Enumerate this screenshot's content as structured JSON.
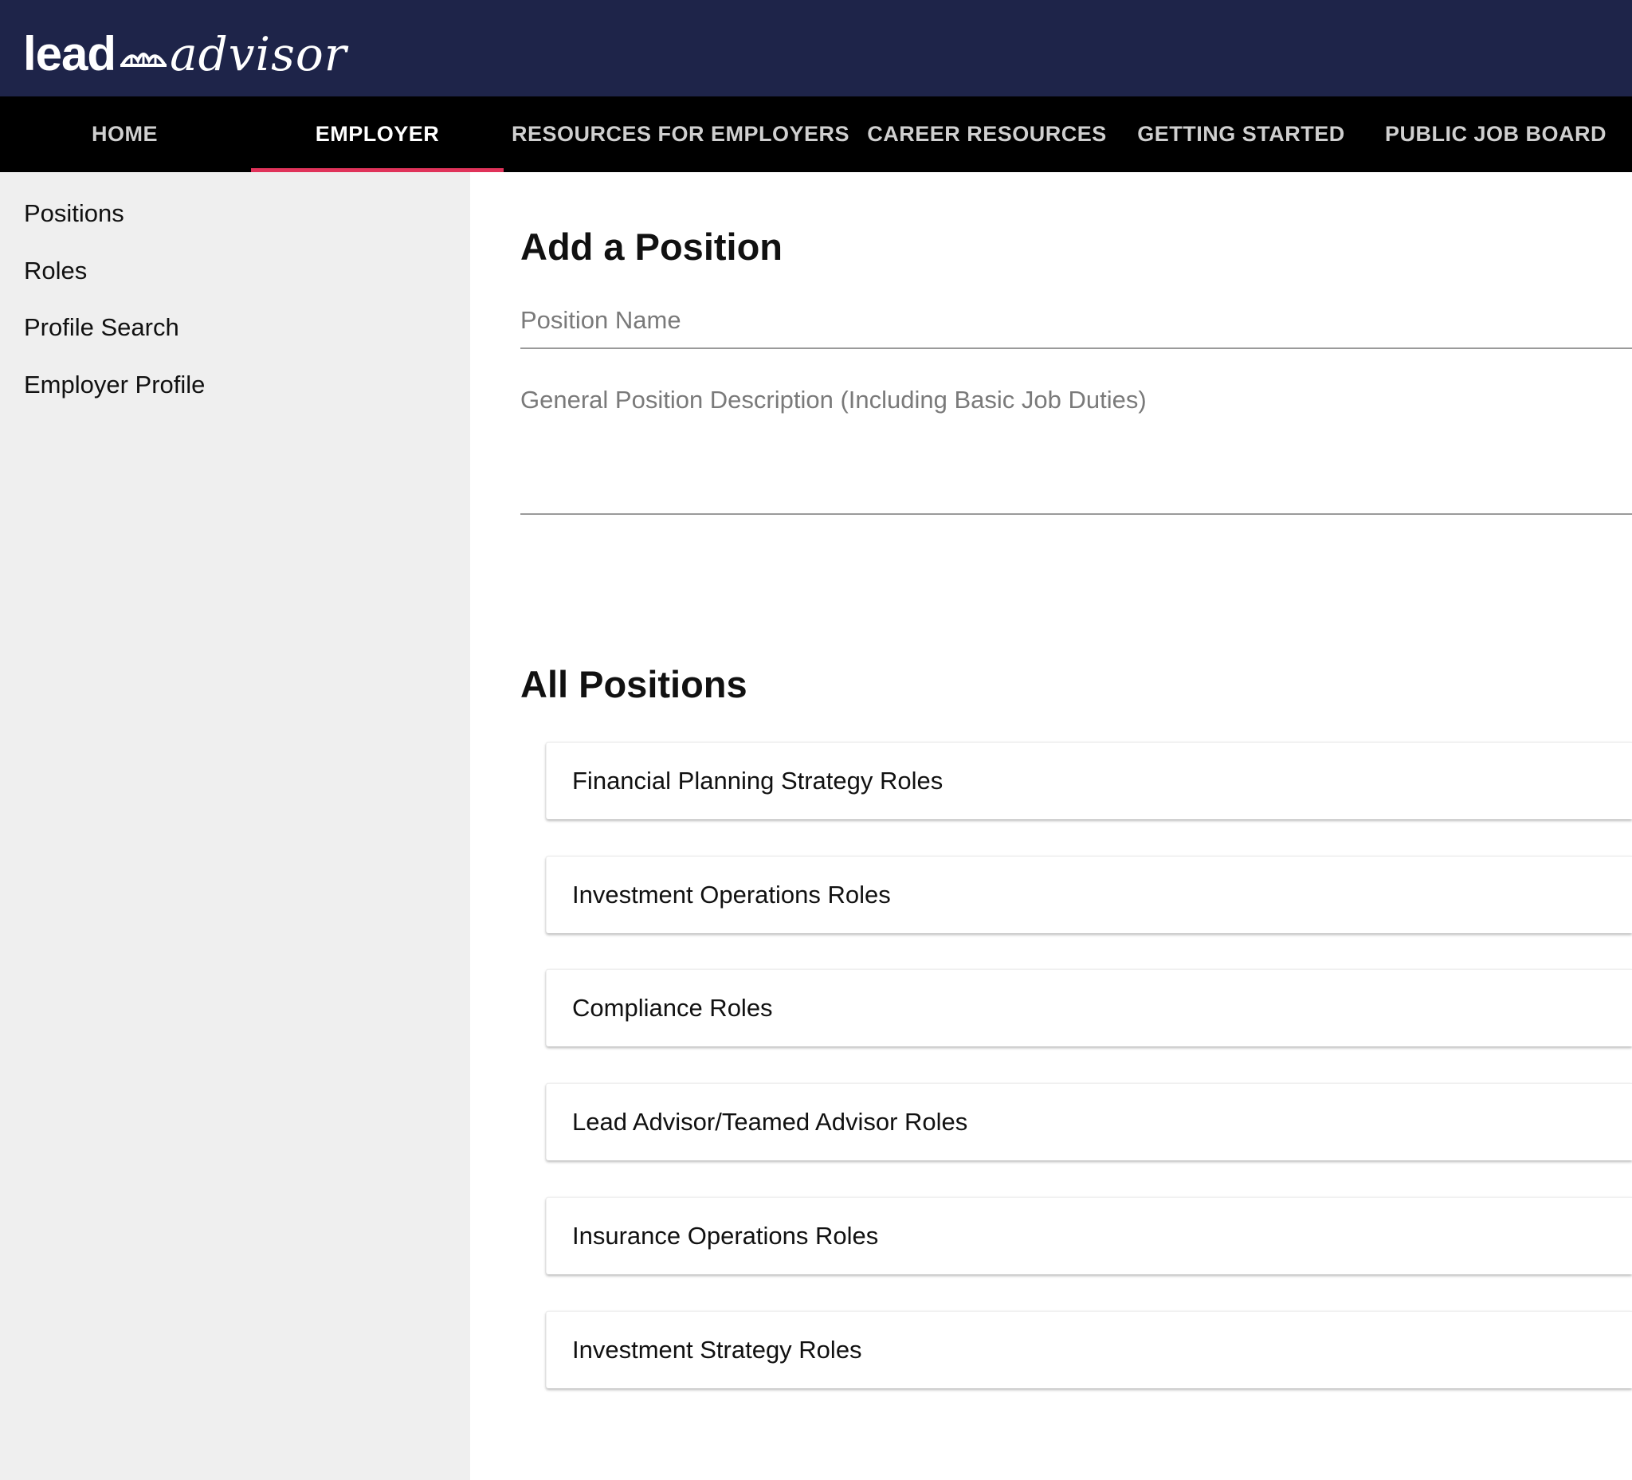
{
  "brand": {
    "logo_part_1": "lead",
    "logo_part_2": "advisor",
    "bar_color": "#1e2449"
  },
  "nav": {
    "items": [
      {
        "label": "HOME",
        "active": false
      },
      {
        "label": "EMPLOYER",
        "active": true
      },
      {
        "label": "RESOURCES FOR EMPLOYERS",
        "active": false
      },
      {
        "label": "CAREER RESOURCES",
        "active": false
      },
      {
        "label": "GETTING STARTED",
        "active": false
      },
      {
        "label": "PUBLIC JOB BOARD",
        "active": false
      }
    ],
    "active_indicator_color": "#e0335a"
  },
  "sidebar": {
    "items": [
      {
        "label": "Positions"
      },
      {
        "label": "Roles"
      },
      {
        "label": "Profile Search"
      },
      {
        "label": "Employer Profile"
      }
    ]
  },
  "add_position": {
    "title": "Add a Position",
    "position_name": {
      "value": "",
      "placeholder": "Position Name"
    },
    "description": {
      "value": "",
      "placeholder": "General Position Description (Including Basic Job Duties)"
    }
  },
  "all_positions": {
    "title": "All Positions",
    "items": [
      {
        "label": "Financial Planning Strategy Roles"
      },
      {
        "label": "Investment Operations Roles"
      },
      {
        "label": "Compliance Roles"
      },
      {
        "label": "Lead Advisor/Teamed Advisor Roles"
      },
      {
        "label": "Insurance Operations Roles"
      },
      {
        "label": "Investment Strategy Roles"
      }
    ]
  }
}
